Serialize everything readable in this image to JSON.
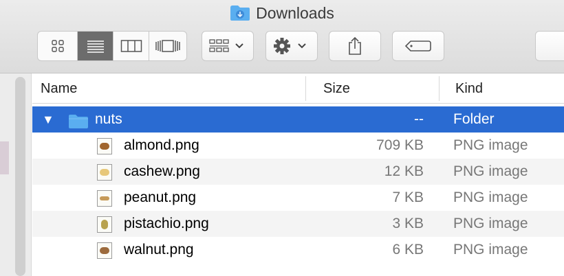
{
  "window": {
    "title": "Downloads"
  },
  "toolbar": {
    "view_icons": "icon-view-icon",
    "view_list": "list-view-icon",
    "view_columns": "column-view-icon",
    "view_coverflow": "coverflow-view-icon",
    "group_icon": "group-by-icon",
    "action_icon": "gear-icon",
    "share_icon": "share-icon",
    "tag_icon": "tag-icon"
  },
  "columns": {
    "name": "Name",
    "size": "Size",
    "kind": "Kind"
  },
  "folder": {
    "name": "nuts",
    "size": "--",
    "kind": "Folder"
  },
  "files": [
    {
      "name": "almond.png",
      "size": "709 KB",
      "kind": "PNG image"
    },
    {
      "name": "cashew.png",
      "size": "12 KB",
      "kind": "PNG image"
    },
    {
      "name": "peanut.png",
      "size": "7 KB",
      "kind": "PNG image"
    },
    {
      "name": "pistachio.png",
      "size": "3 KB",
      "kind": "PNG image"
    },
    {
      "name": "walnut.png",
      "size": "6 KB",
      "kind": "PNG image"
    }
  ],
  "colors": {
    "selection": "#2a6bd2",
    "folder": "#5aaef0"
  }
}
